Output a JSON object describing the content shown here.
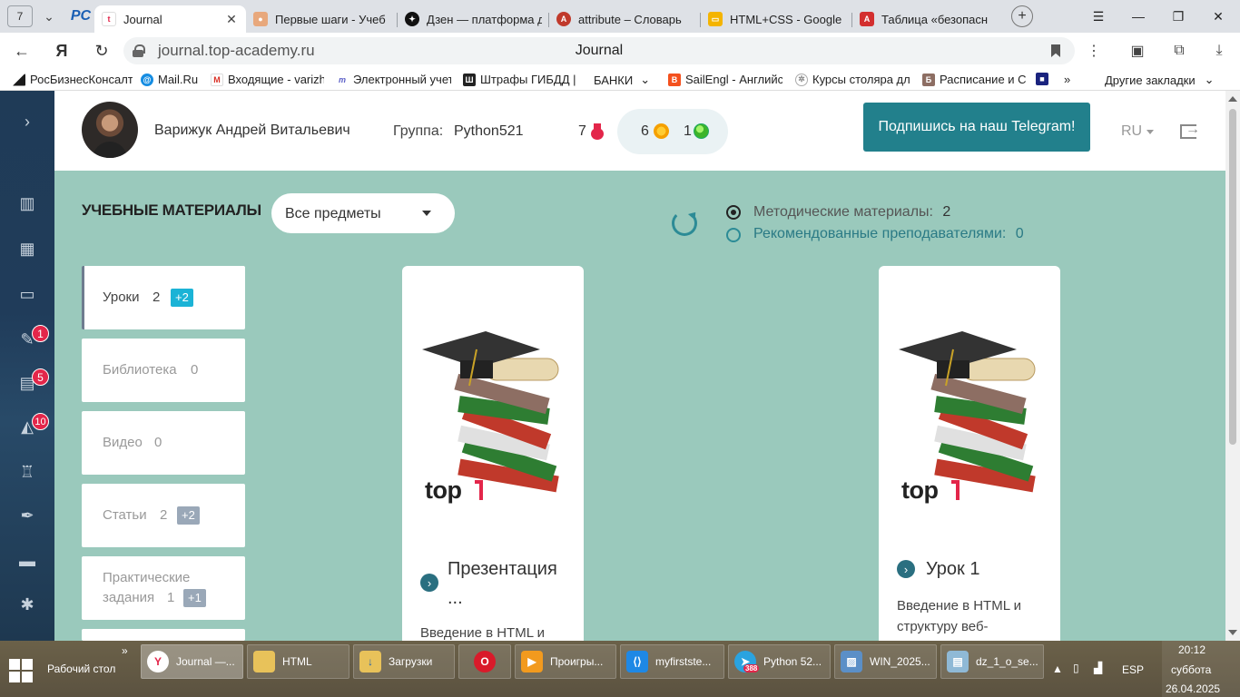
{
  "browser": {
    "tab_count": "7",
    "tabs": [
      {
        "title": "Journal",
        "icon": "top-academy-icon",
        "active": true
      },
      {
        "title": "Первые шаги - Учеб",
        "icon": "user-icon"
      },
      {
        "title": "Дзен — платформа д",
        "icon": "dzen-icon"
      },
      {
        "title": "attribute – Словарь",
        "icon": "dictionary-icon"
      },
      {
        "title": "HTML+CSS - Google",
        "icon": "google-slides-icon"
      },
      {
        "title": "Таблица «безопасн",
        "icon": "table-icon"
      }
    ],
    "url": "journal.top-academy.ru",
    "page_title": "Journal",
    "bookmarks": [
      "РосБизнесКонсалт",
      "Mail.Ru",
      "Входящие - varizh",
      "Электронный учет",
      "Штрафы ГИБДД |",
      "БАНКИ",
      "SailEngl - Английс",
      "Курсы столяра для",
      "Расписание и Стои"
    ],
    "other_bookmarks": "Другие закладки",
    "more_bookmarks": "»"
  },
  "sidebar": {
    "badges": {
      "homework": "1",
      "library": "5",
      "notifications": "10"
    }
  },
  "header": {
    "user_name": "Варижук Андрей Витальевич",
    "group_label": "Группа:",
    "group_value": "Python521",
    "rank": "7",
    "coins": "6",
    "gems": "1",
    "telegram_button": "Подпишись на наш Telegram!",
    "language": "RU"
  },
  "materials": {
    "section_title": "УЧЕБНЫЕ МАТЕРИАЛЫ",
    "subject_select": "Все предметы",
    "filters": [
      {
        "label": "Методические материалы:",
        "count": "2",
        "selected": true
      },
      {
        "label": "Рекомендованные преподавателями:",
        "count": "0",
        "selected": false
      }
    ],
    "categories": [
      {
        "label": "Уроки",
        "count": "2",
        "plus": "+2"
      },
      {
        "label": "Библиотека",
        "count": "0"
      },
      {
        "label": "Видео",
        "count": "0"
      },
      {
        "label": "Статьи",
        "count": "2",
        "plus": "+2"
      },
      {
        "label": "Практические задания",
        "label_line1": "Практические",
        "label_line2": "задания",
        "count": "1",
        "plus": "+1"
      }
    ],
    "cards": [
      {
        "logo": "top",
        "title_line1": "Презентация",
        "title_line2": "...",
        "desc_line1": "Введение в HTML и"
      },
      {
        "logo": "top",
        "title_line1": "Урок 1",
        "desc_line1": "Введение в HTML и",
        "desc_line2": "структуру веб-"
      }
    ]
  },
  "taskbar": {
    "desktop_label": "Рабочий стол",
    "items": [
      {
        "label": "Journal —...",
        "icon": "yandex-browser-icon"
      },
      {
        "label": "HTML",
        "icon": "folder-icon"
      },
      {
        "label": "Загрузки",
        "icon": "downloads-folder-icon"
      },
      {
        "label": "",
        "icon": "opera-icon"
      },
      {
        "label": "Проигры...",
        "icon": "media-player-icon"
      },
      {
        "label": "myfirstste...",
        "icon": "vscode-icon"
      },
      {
        "label": "Python 52...",
        "icon": "telegram-icon",
        "badge": "388"
      },
      {
        "label": "WIN_2025...",
        "icon": "image-icon"
      },
      {
        "label": "dz_1_o_se...",
        "icon": "notepad-icon"
      }
    ],
    "language": "ESP",
    "time": "20:12",
    "weekday": "суббота",
    "date": "26.04.2025"
  },
  "colors": {
    "accent": "#22808c",
    "background": "#9ac9bc",
    "badge_red": "#e3264a",
    "sidebar": "#203c5a"
  }
}
